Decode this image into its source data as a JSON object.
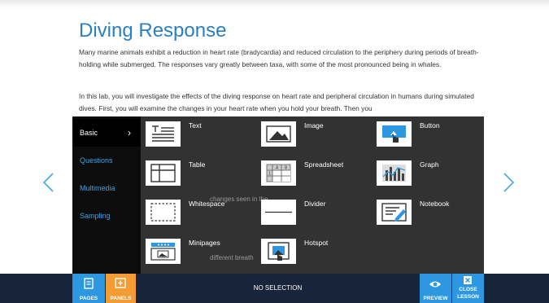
{
  "lesson": {
    "title": "Diving Response",
    "para1": "Many marine animals exhibit a reduction in heart rate (bradycardia) and reduced circulation to the periphery during periods of breath-holding while submerged. The responses vary greatly between taxa, with some of the most pronounced being in whales.",
    "para2": "In this lab, you will investigate the effects of the diving response on heart rate and peripheral circulation in humans during simulated dives. First, you will examine the changes in your heart rate when you hold your breath. Then you",
    "ghost1": "changes seen in the",
    "ghost2": "different breath"
  },
  "panel": {
    "menu": [
      {
        "label": "Basic",
        "active": true
      },
      {
        "label": "Questions"
      },
      {
        "label": "Multimedia"
      },
      {
        "label": "Sampling"
      }
    ],
    "chevron": "›",
    "tiles": {
      "text": "Text",
      "image": "Image",
      "button": "Button",
      "table": "Table",
      "spreadsheet": "Spreadsheet",
      "graph": "Graph",
      "whitespace": "Whitespace",
      "divider": "Divider",
      "notebook": "Notebook",
      "minipages": "Minipages",
      "hotspot": "Hotspot"
    },
    "spreadsheet_cells": [
      "A",
      "B",
      "1"
    ]
  },
  "bottom_bar": {
    "pages": "PAGES",
    "panels": "PANELS",
    "status": "NO SELECTION",
    "preview": "PREVIEW",
    "close_line1": "CLOSE",
    "close_line2": "LESSON"
  },
  "colors": {
    "accent_blue": "#2e97e2",
    "accent_orange": "#f39c34",
    "bar_navy": "#17243a",
    "title_blue": "#2a7fc0",
    "menu_link": "#3aa5e8"
  }
}
